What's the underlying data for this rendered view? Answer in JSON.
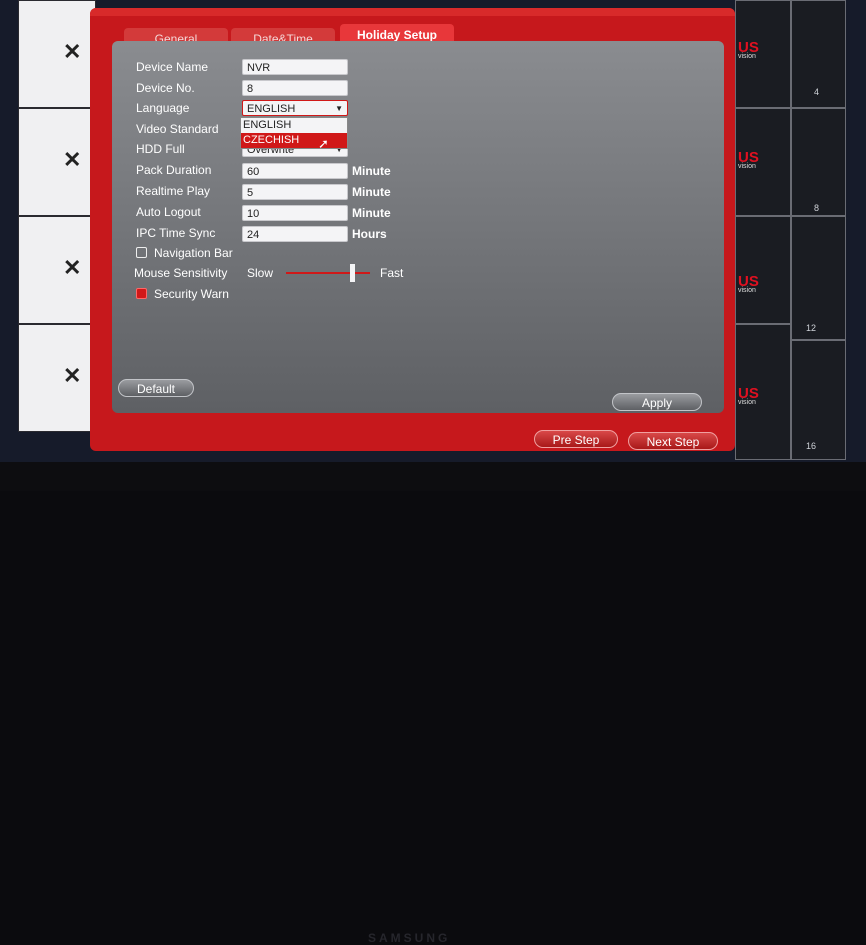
{
  "background": {
    "camera_numbers": [
      "4",
      "8",
      "12",
      "16"
    ],
    "logo_text": "US",
    "logo_sub": "vision"
  },
  "tabs": [
    {
      "label": "General"
    },
    {
      "label": "Date&Time"
    },
    {
      "label": "Holiday Setup"
    }
  ],
  "form": {
    "device_name": {
      "label": "Device Name",
      "value": "NVR"
    },
    "device_no": {
      "label": "Device No.",
      "value": "8"
    },
    "language": {
      "label": "Language",
      "value": "ENGLISH",
      "options": [
        "ENGLISH",
        "CZECHISH"
      ]
    },
    "video_standard": {
      "label": "Video Standard"
    },
    "hdd_full": {
      "label": "HDD Full",
      "value": "Overwrite"
    },
    "pack_duration": {
      "label": "Pack Duration",
      "value": "60",
      "unit": "Minute"
    },
    "realtime_play": {
      "label": "Realtime Play",
      "value": "5",
      "unit": "Minute"
    },
    "auto_logout": {
      "label": "Auto Logout",
      "value": "10",
      "unit": "Minute"
    },
    "ipc_time_sync": {
      "label": "IPC Time Sync",
      "value": "24",
      "unit": "Hours"
    },
    "navigation_bar": {
      "label": "Navigation Bar",
      "checked": false
    },
    "mouse_sensitivity": {
      "label": "Mouse Sensitivity",
      "min_label": "Slow",
      "max_label": "Fast",
      "level": 1.0
    },
    "security_warn": {
      "label": "Security Warn",
      "checked": true
    }
  },
  "buttons": {
    "default": "Default",
    "apply": "Apply",
    "pre_step": "Pre Step",
    "next_step": "Next Step"
  },
  "monitor_brand": "SAMSUNG",
  "colors": {
    "accent_red": "#c6181c",
    "highlight": "#d01818"
  }
}
